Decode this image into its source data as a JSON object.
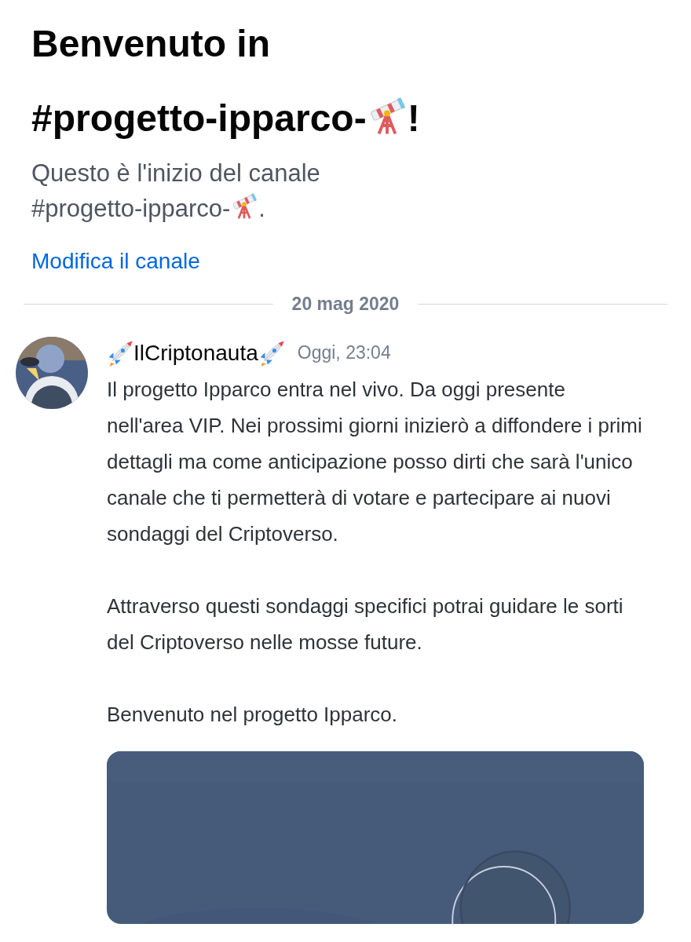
{
  "channel_header": {
    "title_line": "Benvenuto in",
    "title_before_icon": "#progetto-ipparco-",
    "title_after_icon": "!",
    "description_line": "Questo è l'inizio del canale",
    "description_before_icon": "#progetto-ipparco-",
    "description_after_icon": ".",
    "edit_link": "Modifica il canale"
  },
  "date_divider": "20 mag 2020",
  "messages": [
    {
      "author": "IlCriptonauta",
      "timestamp": "Oggi, 23:04",
      "paragraphs": [
        "Il progetto Ipparco entra nel vivo. Da oggi presente nell'area VIP. Nei prossimi giorni inizierò a diffondere i primi dettagli ma come anticipazione posso dirti che sarà l'unico canale che ti permetterà di votare e partecipare ai nuovi sondaggi del Criptoverso.",
        "Attraverso questi sondaggi specifici potrai guidare le sorti del Criptoverso nelle mosse future.",
        "Benvenuto nel progetto Ipparco."
      ]
    }
  ]
}
